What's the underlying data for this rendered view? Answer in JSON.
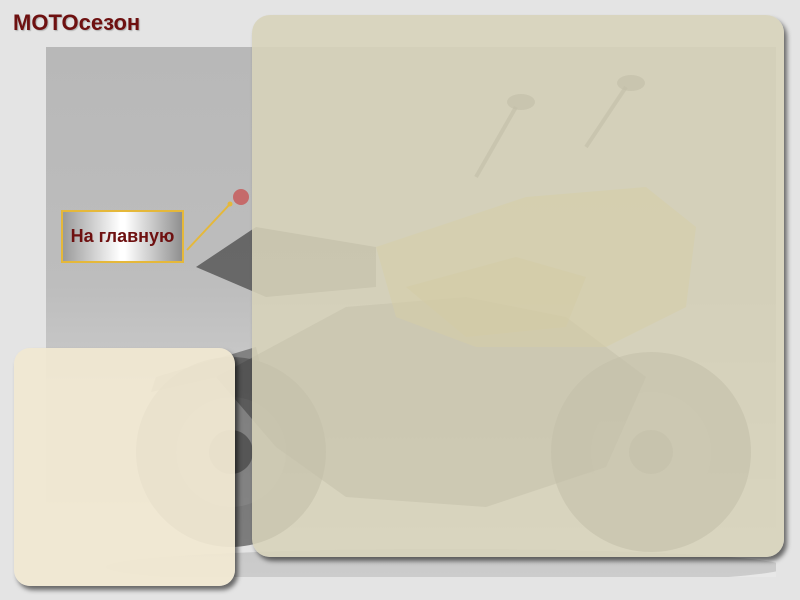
{
  "header": {
    "site_title": "MOTOсезон"
  },
  "nav": {
    "home_label": "На главную"
  },
  "hero": {
    "image_subject": "motorcycle-photo"
  },
  "colors": {
    "title": "#6e1010",
    "nav_border": "#e5b83a",
    "panel": "#d7d3ba",
    "side_panel": "#f0e8d2",
    "background": "#e4e4e4"
  }
}
